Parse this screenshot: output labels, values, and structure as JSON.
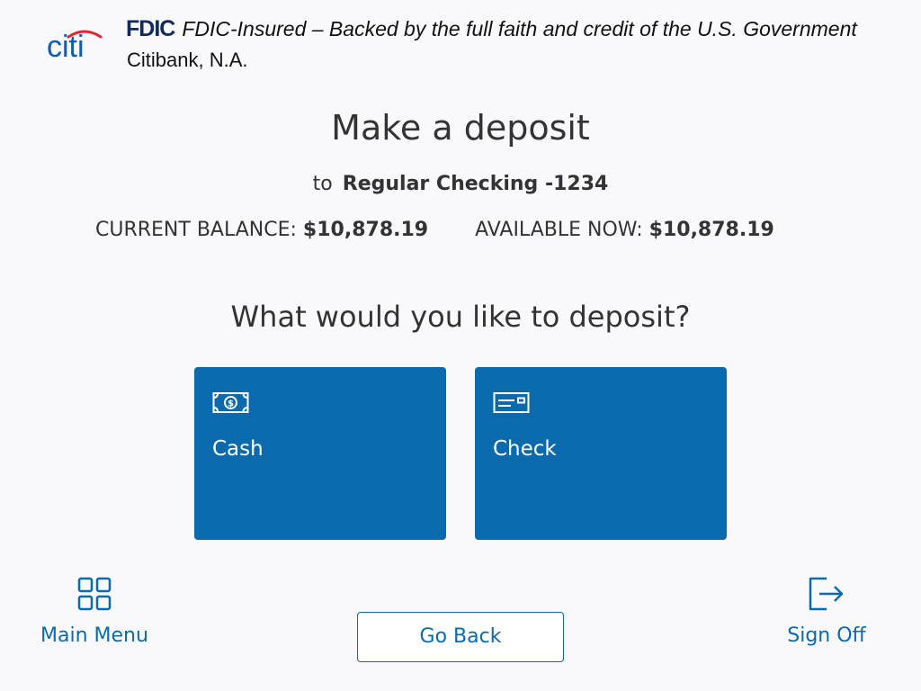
{
  "header": {
    "logo_text": "citi",
    "fdic_mark": "FDIC",
    "fdic_text": "FDIC-Insured – Backed by the full faith and credit of the U.S. Government",
    "bank_name": "Citibank, N.A."
  },
  "page": {
    "title": "Make a deposit",
    "to_prefix": "to",
    "account_name": "Regular Checking -1234"
  },
  "balances": {
    "current_label": "CURRENT BALANCE:",
    "current_value": "$10,878.19",
    "available_label": "AVAILABLE NOW:",
    "available_value": "$10,878.19"
  },
  "prompt": "What would you like to deposit?",
  "options": [
    {
      "label": "Cash",
      "icon": "cash-icon"
    },
    {
      "label": "Check",
      "icon": "check-icon"
    }
  ],
  "footer": {
    "main_menu_label": "Main Menu",
    "main_menu_icon": "grid-icon",
    "go_back_label": "Go Back",
    "sign_off_label": "Sign Off",
    "sign_off_icon": "exit-icon"
  },
  "colors": {
    "brand_blue": "#0b6aac",
    "logo_blue": "#0f5bb8",
    "logo_red": "#e3262d",
    "fdic_navy": "#0f2a5c",
    "background": "#f9f9fb"
  }
}
